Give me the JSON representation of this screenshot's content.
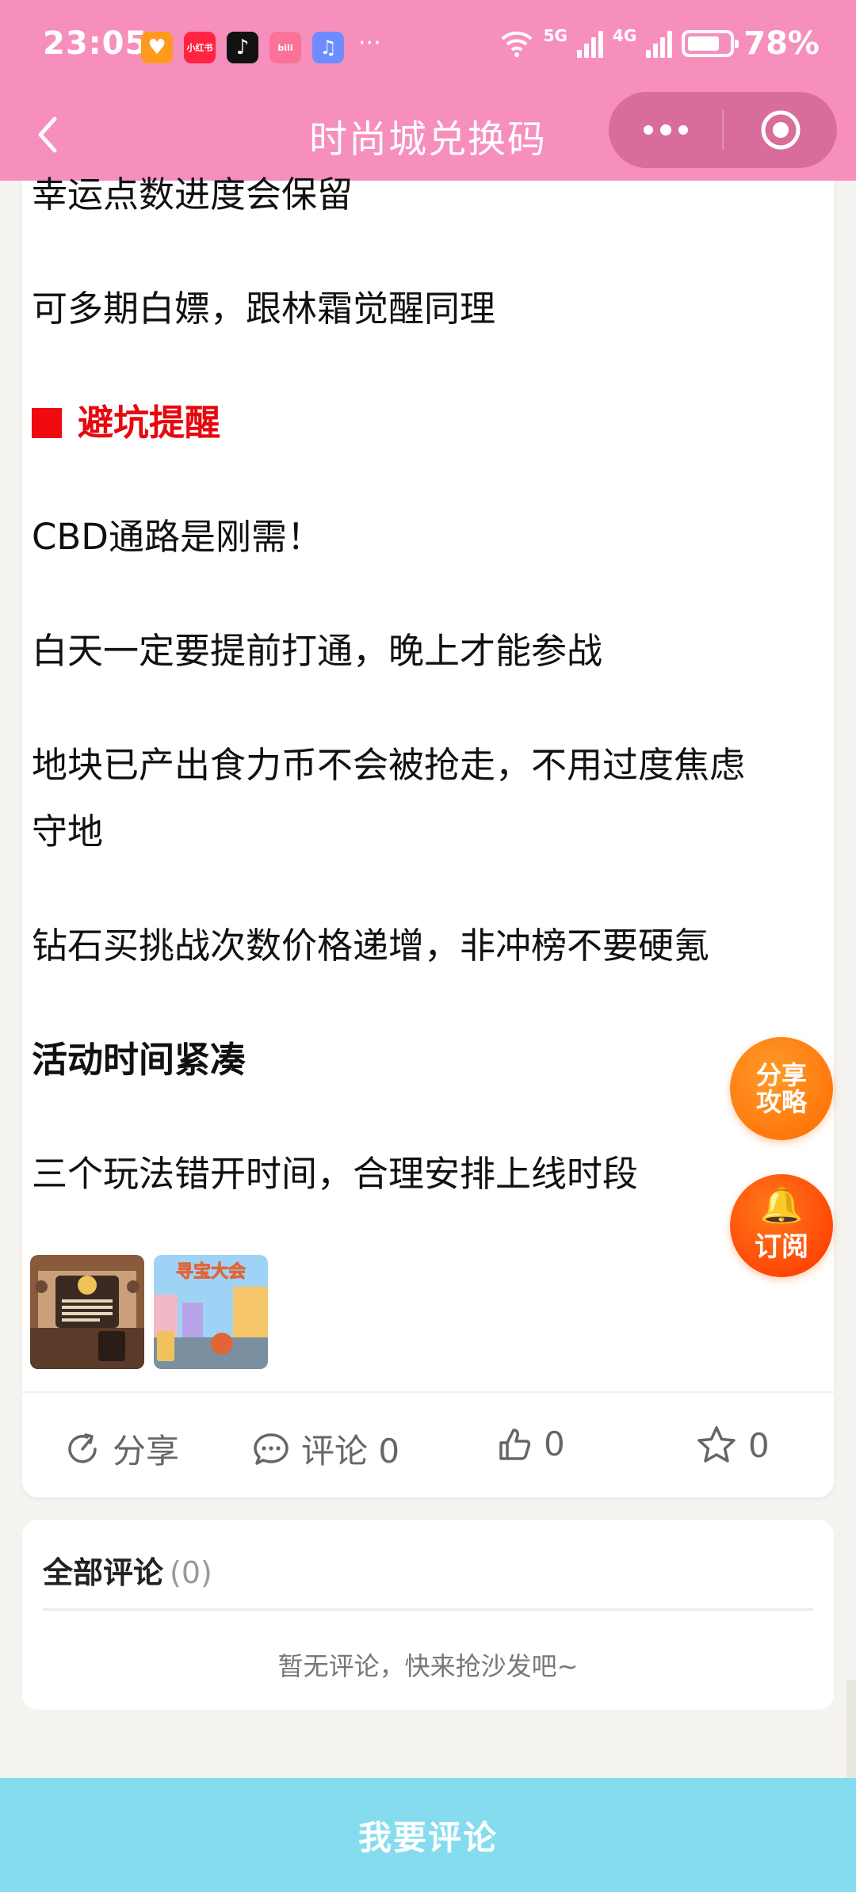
{
  "status_bar": {
    "time": "23:05",
    "app_icons": [
      "heart-app-icon",
      "xiaohongshu-icon",
      "tiktok-icon",
      "bilibili-icon",
      "music-icon"
    ],
    "more": "···",
    "network_5g": "5G",
    "network_4g": "4G",
    "battery_percent": "78%",
    "battery_level": 0.78
  },
  "nav": {
    "title": "时尚城兑换码"
  },
  "article": {
    "lines": [
      "幸运点数进度会保留",
      "可多期白嫖，跟林霜觉醒同理",
      "避坑提醒",
      "CBD通路是刚需！",
      "白天一定要提前打通，晚上才能参战",
      "地块已产出食力币不会被抢走，不用过度焦虑",
      "守地",
      "钻石买挑战次数价格递增，非冲榜不要硬氪",
      "活动时间紧凑",
      "三个玩法错开时间，合理安排上线时段"
    ],
    "thumb2_caption": "寻宝大会"
  },
  "actions": {
    "share": "分享",
    "comment": "评论 0",
    "like_count": "0",
    "favorite_count": "0"
  },
  "comments": {
    "header": "全部评论",
    "count": "(0)",
    "empty": "暂无评论，快来抢沙发吧~"
  },
  "floating": {
    "share": "分享攻略",
    "subscribe": "订阅"
  },
  "bottom": {
    "comment_button": "我要评论"
  },
  "colors": {
    "header_pink": "#f78fbd",
    "capsule_pink": "#d86d9c",
    "warning_red": "#e8070e",
    "float_orange": "#ff7a00",
    "comment_bar_blue": "#86dcef"
  }
}
